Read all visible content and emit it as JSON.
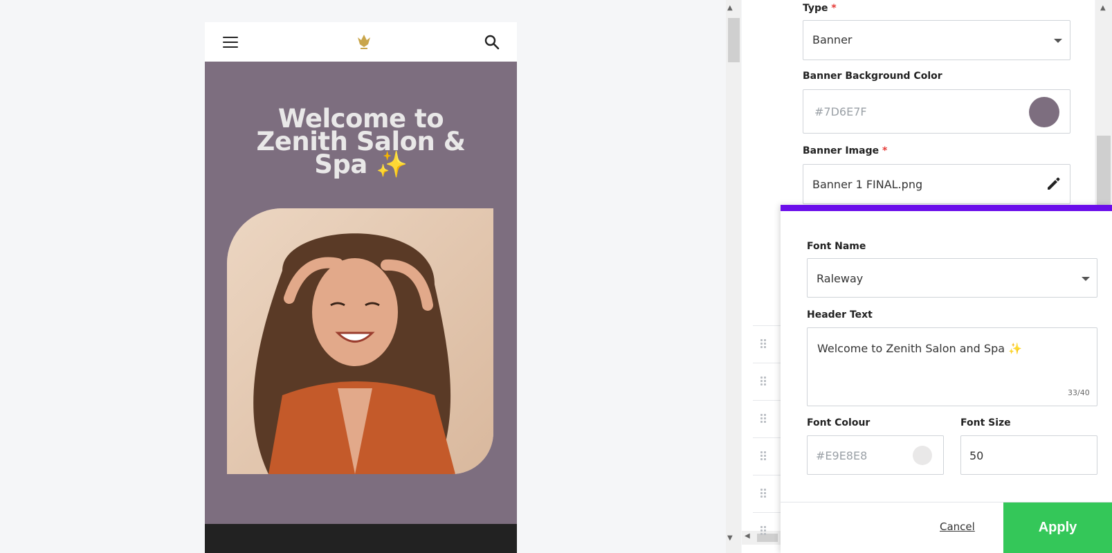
{
  "phone": {
    "title": "Welcome to Zenith Salon & Spa ✨",
    "banner_color": "#7D6E7F",
    "title_color": "#E9E8E8"
  },
  "panel": {
    "type_label": "Type",
    "type_value": "Banner",
    "bg_color_label": "Banner Background Color",
    "bg_color_value": "#7D6E7F",
    "banner_image_label": "Banner Image",
    "banner_image_value": "Banner 1 FINAL.png",
    "required_mark": "*"
  },
  "overlay": {
    "font_name_label": "Font Name",
    "font_name_value": "Raleway",
    "header_text_label": "Header Text",
    "header_text_value": "Welcome to Zenith Salon and Spa ✨",
    "char_counter": "33/40",
    "font_colour_label": "Font Colour",
    "font_colour_value": "#E9E8E8",
    "font_size_label": "Font Size",
    "font_size_value": "50",
    "cancel_label": "Cancel",
    "apply_label": "Apply",
    "accent_color": "#6a0dea",
    "apply_color": "#34c759"
  },
  "icons": {
    "menu": "hamburger-icon",
    "logo": "phoenix-logo",
    "search": "search-icon",
    "edit": "pencil-icon",
    "dropdown": "chevron-down-icon",
    "grip": "drag-handle-icon"
  }
}
